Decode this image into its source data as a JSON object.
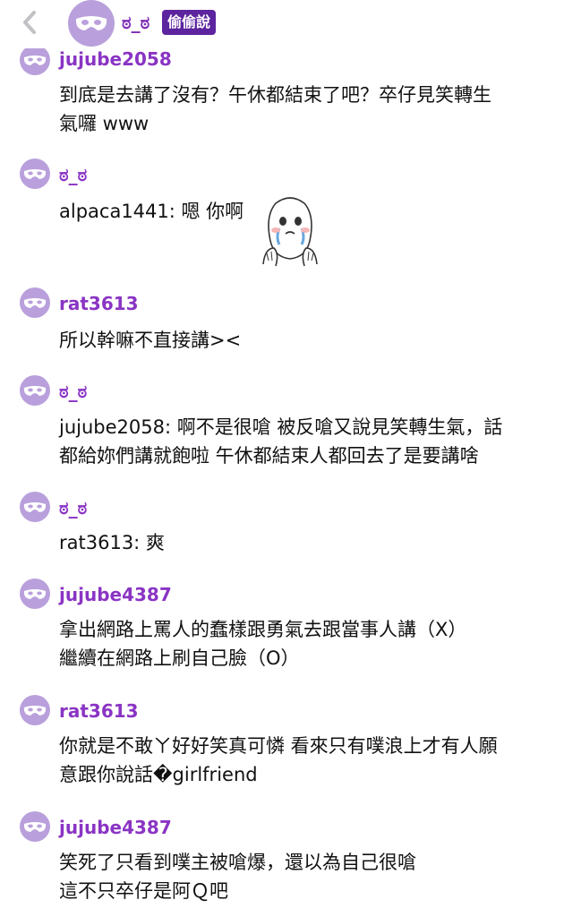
{
  "header": {
    "name": "ಠ_ಠ",
    "badge": "偷偷說",
    "back_icon": "chevron-left-icon",
    "avatar_icon": "mask-icon"
  },
  "colors": {
    "author": "#8a34c4",
    "badge_bg": "#5c249f",
    "avatar_bg": "#b9a0dc"
  },
  "comments": [
    {
      "author": "jujube2058",
      "lines": [
        "到底是去講了沒有？午休都結束了吧？卒仔見笑轉生",
        "氣囉 www"
      ]
    },
    {
      "author": "ಠ_ಠ",
      "lines": [
        "alpaca1441: 嗯 你啊"
      ],
      "sticker": "crying-face-sticker"
    },
    {
      "author": "rat3613",
      "lines": [
        "所以幹嘛不直接講><"
      ]
    },
    {
      "author": "ಠ_ಠ",
      "lines": [
        "jujube2058: 啊不是很嗆 被反嗆又說見笑轉生氣，話",
        "都給妳們講就飽啦 午休都結束人都回去了是要講啥"
      ]
    },
    {
      "author": "ಠ_ಠ",
      "lines": [
        "rat3613: 爽"
      ]
    },
    {
      "author": "jujube4387",
      "lines": [
        "拿出網路上罵人的蠢樣跟勇氣去跟當事人講（X）",
        "繼續在網路上刷自己臉（O）"
      ]
    },
    {
      "author": "rat3613",
      "lines": [
        "你就是不敢ㄚ好好笑真可憐 看來只有噗浪上才有人願",
        "意跟你說話�girlfriend"
      ]
    },
    {
      "author": "jujube4387",
      "lines": [
        "笑死了只看到噗主被嗆爆，還以為自己很嗆",
        "這不只卒仔是阿Ｑ吧"
      ]
    }
  ]
}
